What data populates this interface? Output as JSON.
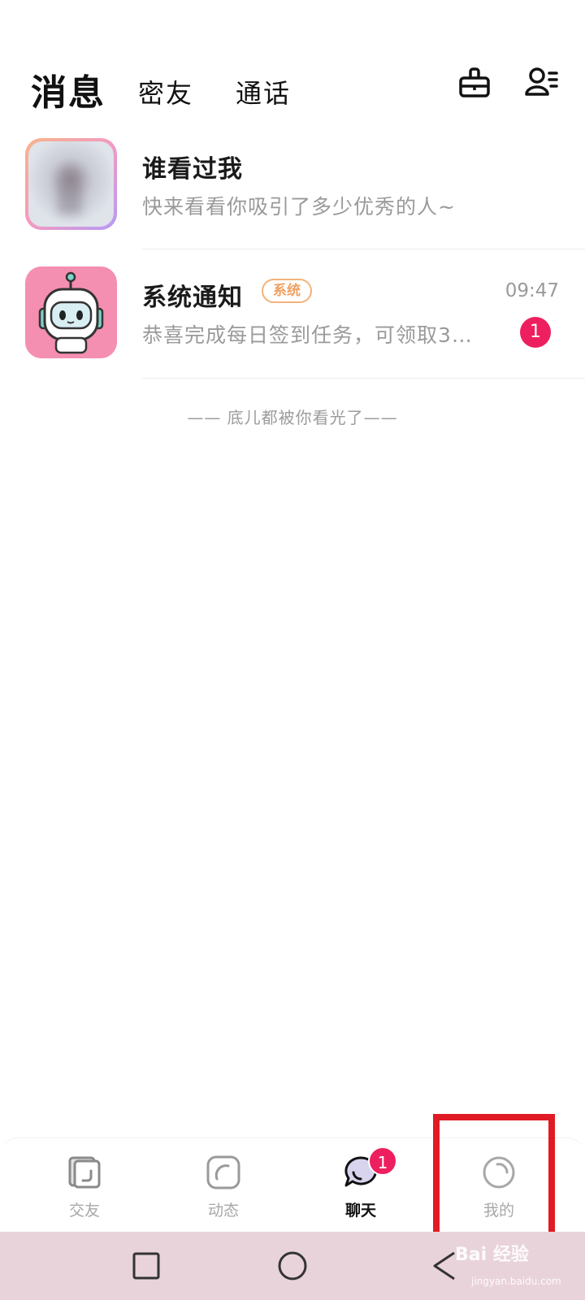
{
  "header": {
    "tabs": [
      {
        "label": "消息",
        "active": true
      },
      {
        "label": "密友",
        "active": false
      },
      {
        "label": "通话",
        "active": false
      }
    ],
    "icons": [
      "clean-icon",
      "contacts-icon"
    ]
  },
  "list": [
    {
      "title": "谁看过我",
      "subtitle": "快来看看你吸引了多少优秀的人~",
      "avatar": "blurred-photo"
    },
    {
      "title": "系统通知",
      "tag": "系统",
      "subtitle": "恭喜完成每日签到任务，可领取3…",
      "time": "09:47",
      "badge": "1",
      "avatar": "robot-icon"
    }
  ],
  "end_note": "—— 底儿都被你看光了——",
  "bottom_nav": {
    "items": [
      {
        "label": "交友",
        "icon": "cards-icon",
        "active": false
      },
      {
        "label": "动态",
        "icon": "moments-icon",
        "active": false
      },
      {
        "label": "聊天",
        "icon": "chat-bubble-icon",
        "active": true,
        "badge": "1"
      },
      {
        "label": "我的",
        "icon": "profile-circle-icon",
        "active": false
      }
    ]
  },
  "watermark": {
    "text": "Bai 经验",
    "sub": "jingyan.baidu.com"
  },
  "colors": {
    "accent": "#ee1f5f",
    "tag": "#f0a060",
    "highlight": "#e01b24",
    "system_bar": "#e9d3da"
  }
}
